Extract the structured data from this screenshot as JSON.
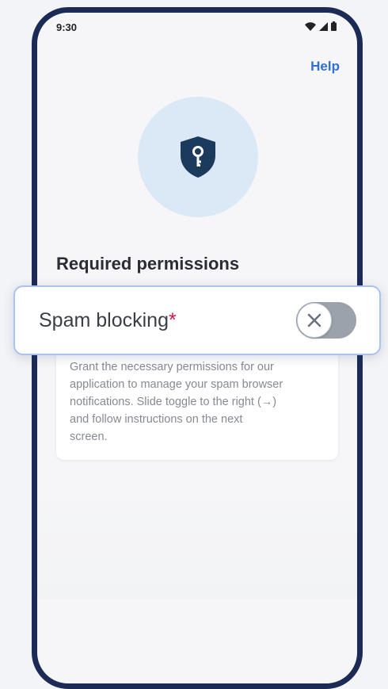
{
  "status_bar": {
    "time": "9:30",
    "icons": [
      "wifi-icon",
      "signal-icon",
      "battery-icon"
    ]
  },
  "header": {
    "help_label": "Help"
  },
  "hero": {
    "icon": "shield-key-icon",
    "circle_color": "#dbe9f6",
    "icon_color": "#1b3a5c"
  },
  "page": {
    "title": "Required permissions"
  },
  "permission_item": {
    "label": "Spam blocking",
    "required_marker": "*",
    "toggle_state": "off",
    "toggle_icon": "close-icon"
  },
  "info_card": {
    "lines": [
      "Grant the necessary permissions for our",
      "application to manage your spam browser",
      "notifications. Slide toggle to the right (→)",
      "and follow instructions on the next",
      "screen."
    ]
  },
  "colors": {
    "accent": "#2f6fd8",
    "required": "#d6144a",
    "frame": "#1c2b55",
    "toggle_off": "#9ba2ac",
    "highlight_border": "#a9c3ec"
  }
}
